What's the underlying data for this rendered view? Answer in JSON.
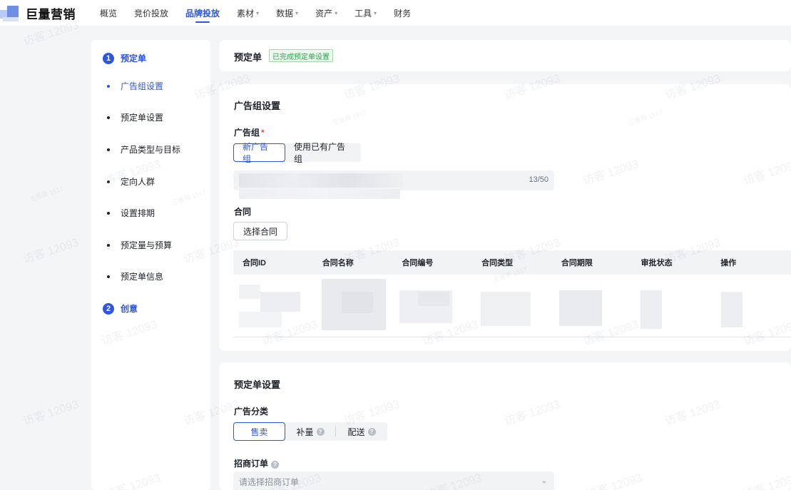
{
  "brand": {
    "name": "巨量营销"
  },
  "nav": {
    "items": [
      {
        "label": "概览",
        "caret": ""
      },
      {
        "label": "竞价投放",
        "caret": ""
      },
      {
        "label": "品牌投放",
        "caret": ""
      },
      {
        "label": "素材",
        "caret": "▾"
      },
      {
        "label": "数据",
        "caret": "▾"
      },
      {
        "label": "资产",
        "caret": "▾"
      },
      {
        "label": "工具",
        "caret": "▾"
      },
      {
        "label": "财务",
        "caret": ""
      }
    ]
  },
  "steps": {
    "step1": {
      "num": "1",
      "title": "预定单"
    },
    "subs": [
      {
        "label": "广告组设置"
      },
      {
        "label": "预定单设置"
      },
      {
        "label": "产品类型与目标"
      },
      {
        "label": "定向人群"
      },
      {
        "label": "设置排期"
      },
      {
        "label": "预定量与预算"
      },
      {
        "label": "预定单信息"
      }
    ],
    "step2": {
      "num": "2",
      "title": "创意"
    }
  },
  "header": {
    "title": "预定单",
    "status_tag": "已完成预定单设置"
  },
  "adgroup": {
    "section_title": "广告组设置",
    "field_label": "广告组",
    "required_mark": "*",
    "options": [
      "新广告组",
      "使用已有广告组"
    ],
    "name_counter": "13/50",
    "contract_label": "合同",
    "select_contract_button": "选择合同",
    "table_headers": [
      "合同ID",
      "合同名称",
      "合同编号",
      "合同类型",
      "合同期限",
      "审批状态",
      "操作"
    ]
  },
  "order": {
    "section_title": "预定单设置",
    "category_label": "广告分类",
    "category_options": [
      "售卖",
      "补量",
      "配送"
    ],
    "help_glyph": "?",
    "merchant_label": "招商订单",
    "merchant_placeholder": "请选择招商订单",
    "chevron": "⌄"
  },
  "watermark": {
    "primary": "访客 12093",
    "secondary": "王普薇 1517"
  }
}
